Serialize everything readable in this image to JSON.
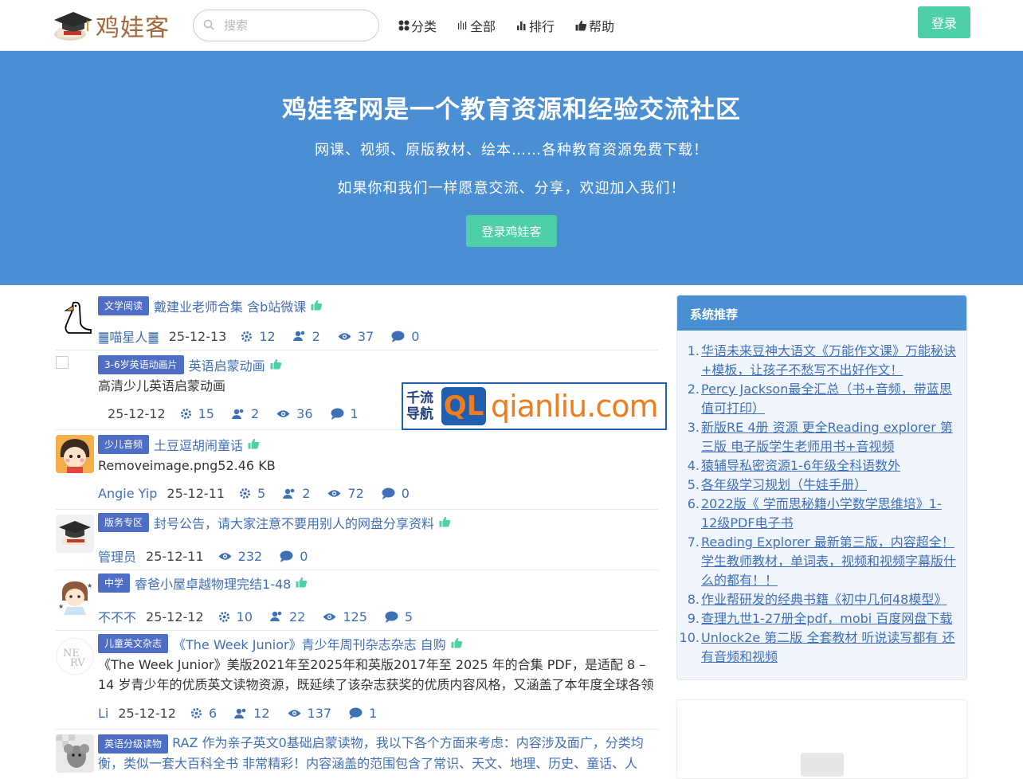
{
  "nav": {
    "logo_text": "鸡娃客",
    "search_placeholder": "搜索",
    "links": [
      {
        "label": "分类",
        "icon": "grid-icon"
      },
      {
        "label": "全部",
        "icon": "bars-icon"
      },
      {
        "label": "排行",
        "icon": "chart-icon"
      },
      {
        "label": "帮助",
        "icon": "thumbs-up-icon"
      }
    ],
    "login_label": "登录"
  },
  "hero": {
    "title": "鸡娃客网是一个教育资源和经验交流社区",
    "sub1": "网课、视频、原版教材、绘本……各种教育资源免费下载！",
    "sub2": "如果你和我们一样愿意交流、分享，欢迎加入我们！",
    "button": "登录鸡娃客"
  },
  "posts": [
    {
      "tag": "文学阅读",
      "title": "戴建业老师合集 含b站微课",
      "excerpt": "",
      "author": "䷀喵星人䷀",
      "date": "25-12-13",
      "likes": "12",
      "follows": "2",
      "views": "37",
      "comments": "0"
    },
    {
      "tag": "3-6岁英语动画片",
      "title": "英语启蒙动画",
      "excerpt": "高清少儿英语启蒙动画",
      "author": "",
      "date": "25-12-12",
      "likes": "15",
      "follows": "2",
      "views": "36",
      "comments": "1"
    },
    {
      "tag": "少儿音频",
      "title": "土豆逗胡闹童话",
      "excerpt": "Removeimage.png52.46 KB",
      "author": "Angie Yip",
      "date": "25-12-11",
      "likes": "5",
      "follows": "2",
      "views": "72",
      "comments": "0"
    },
    {
      "tag": "版务专区",
      "title": "封号公告，请大家注意不要用别人的网盘分享资料",
      "excerpt": "",
      "author": "管理员",
      "date": "25-12-11",
      "views": "232",
      "comments": "0"
    },
    {
      "tag": "中学",
      "title": "睿爸小屋卓越物理完结1-48",
      "excerpt": "",
      "author": "不不不",
      "date": "25-12-12",
      "likes": "10",
      "follows": "22",
      "views": "125",
      "comments": "5"
    },
    {
      "tag": "儿童英文杂志",
      "title": "《The Week Junior》青少年周刊杂志杂志 自购",
      "excerpt": "《The Week Junior》美版2021年至2025年和英版2017年至 2025 年的合集 PDF，是适配 8 – 14 岁青少年的优质英文读物资源，既延续了该杂志获奖的优质内容风格，又涵盖了本年度全球各领域的…",
      "author": "Li",
      "date": "25-12-12",
      "likes": "6",
      "follows": "12",
      "views": "137",
      "comments": "1"
    },
    {
      "tag": "英语分级读物",
      "title": "RAZ 作为亲子英文0基础启蒙读物，我以下各个方面来考虑：内容涉及面广，分类均衡，类似一套大百科全书 非常精彩！内容涵盖的范围包含了常识、天文、地理、历史、童话、人",
      "excerpt": "",
      "author": "",
      "date": "",
      "likes": "",
      "follows": "",
      "views": "",
      "comments": ""
    }
  ],
  "watermark": {
    "cn_line1": "千流",
    "cn_line2": "导航",
    "ql": "QL",
    "domain": "qianliu.com"
  },
  "sidebar": {
    "title": "系统推荐",
    "items": [
      "华语未来豆神大语文《万能作文课》万能秘诀+模板，让孩子不愁写不出好作文！",
      "Percy Jackson最全汇总（书+音频，带蓝思值可打印）",
      "新版RE 4册 资源 更全Reading explorer 第三版 电子版学生老师用书+音视频",
      "猿辅导私密资源1-6年级全科语数外",
      "各年级学习规划（牛娃手册）",
      "2022版《 学而思秘籍小学数学思维培》1-12级PDF电子书",
      "Reading Explorer 最新第三版，内容超全！学生教师教材，单词表，视频和视频字幕版什么的都有！！",
      "作业帮研发的经典书籍《初中几何48模型》",
      "查理九世1-27册全pdf，mobi 百度网盘下载",
      "Unlock2e 第二版 全套教材 听说读写都有 还有音频和视频"
    ]
  }
}
